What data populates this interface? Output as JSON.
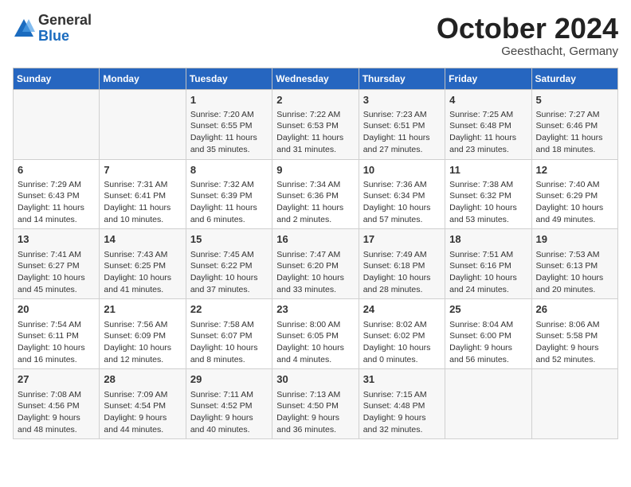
{
  "header": {
    "logo_general": "General",
    "logo_blue": "Blue",
    "month": "October 2024",
    "location": "Geesthacht, Germany"
  },
  "days_of_week": [
    "Sunday",
    "Monday",
    "Tuesday",
    "Wednesday",
    "Thursday",
    "Friday",
    "Saturday"
  ],
  "weeks": [
    [
      {
        "num": "",
        "info": ""
      },
      {
        "num": "",
        "info": ""
      },
      {
        "num": "1",
        "info": "Sunrise: 7:20 AM\nSunset: 6:55 PM\nDaylight: 11 hours and 35 minutes."
      },
      {
        "num": "2",
        "info": "Sunrise: 7:22 AM\nSunset: 6:53 PM\nDaylight: 11 hours and 31 minutes."
      },
      {
        "num": "3",
        "info": "Sunrise: 7:23 AM\nSunset: 6:51 PM\nDaylight: 11 hours and 27 minutes."
      },
      {
        "num": "4",
        "info": "Sunrise: 7:25 AM\nSunset: 6:48 PM\nDaylight: 11 hours and 23 minutes."
      },
      {
        "num": "5",
        "info": "Sunrise: 7:27 AM\nSunset: 6:46 PM\nDaylight: 11 hours and 18 minutes."
      }
    ],
    [
      {
        "num": "6",
        "info": "Sunrise: 7:29 AM\nSunset: 6:43 PM\nDaylight: 11 hours and 14 minutes."
      },
      {
        "num": "7",
        "info": "Sunrise: 7:31 AM\nSunset: 6:41 PM\nDaylight: 11 hours and 10 minutes."
      },
      {
        "num": "8",
        "info": "Sunrise: 7:32 AM\nSunset: 6:39 PM\nDaylight: 11 hours and 6 minutes."
      },
      {
        "num": "9",
        "info": "Sunrise: 7:34 AM\nSunset: 6:36 PM\nDaylight: 11 hours and 2 minutes."
      },
      {
        "num": "10",
        "info": "Sunrise: 7:36 AM\nSunset: 6:34 PM\nDaylight: 10 hours and 57 minutes."
      },
      {
        "num": "11",
        "info": "Sunrise: 7:38 AM\nSunset: 6:32 PM\nDaylight: 10 hours and 53 minutes."
      },
      {
        "num": "12",
        "info": "Sunrise: 7:40 AM\nSunset: 6:29 PM\nDaylight: 10 hours and 49 minutes."
      }
    ],
    [
      {
        "num": "13",
        "info": "Sunrise: 7:41 AM\nSunset: 6:27 PM\nDaylight: 10 hours and 45 minutes."
      },
      {
        "num": "14",
        "info": "Sunrise: 7:43 AM\nSunset: 6:25 PM\nDaylight: 10 hours and 41 minutes."
      },
      {
        "num": "15",
        "info": "Sunrise: 7:45 AM\nSunset: 6:22 PM\nDaylight: 10 hours and 37 minutes."
      },
      {
        "num": "16",
        "info": "Sunrise: 7:47 AM\nSunset: 6:20 PM\nDaylight: 10 hours and 33 minutes."
      },
      {
        "num": "17",
        "info": "Sunrise: 7:49 AM\nSunset: 6:18 PM\nDaylight: 10 hours and 28 minutes."
      },
      {
        "num": "18",
        "info": "Sunrise: 7:51 AM\nSunset: 6:16 PM\nDaylight: 10 hours and 24 minutes."
      },
      {
        "num": "19",
        "info": "Sunrise: 7:53 AM\nSunset: 6:13 PM\nDaylight: 10 hours and 20 minutes."
      }
    ],
    [
      {
        "num": "20",
        "info": "Sunrise: 7:54 AM\nSunset: 6:11 PM\nDaylight: 10 hours and 16 minutes."
      },
      {
        "num": "21",
        "info": "Sunrise: 7:56 AM\nSunset: 6:09 PM\nDaylight: 10 hours and 12 minutes."
      },
      {
        "num": "22",
        "info": "Sunrise: 7:58 AM\nSunset: 6:07 PM\nDaylight: 10 hours and 8 minutes."
      },
      {
        "num": "23",
        "info": "Sunrise: 8:00 AM\nSunset: 6:05 PM\nDaylight: 10 hours and 4 minutes."
      },
      {
        "num": "24",
        "info": "Sunrise: 8:02 AM\nSunset: 6:02 PM\nDaylight: 10 hours and 0 minutes."
      },
      {
        "num": "25",
        "info": "Sunrise: 8:04 AM\nSunset: 6:00 PM\nDaylight: 9 hours and 56 minutes."
      },
      {
        "num": "26",
        "info": "Sunrise: 8:06 AM\nSunset: 5:58 PM\nDaylight: 9 hours and 52 minutes."
      }
    ],
    [
      {
        "num": "27",
        "info": "Sunrise: 7:08 AM\nSunset: 4:56 PM\nDaylight: 9 hours and 48 minutes."
      },
      {
        "num": "28",
        "info": "Sunrise: 7:09 AM\nSunset: 4:54 PM\nDaylight: 9 hours and 44 minutes."
      },
      {
        "num": "29",
        "info": "Sunrise: 7:11 AM\nSunset: 4:52 PM\nDaylight: 9 hours and 40 minutes."
      },
      {
        "num": "30",
        "info": "Sunrise: 7:13 AM\nSunset: 4:50 PM\nDaylight: 9 hours and 36 minutes."
      },
      {
        "num": "31",
        "info": "Sunrise: 7:15 AM\nSunset: 4:48 PM\nDaylight: 9 hours and 32 minutes."
      },
      {
        "num": "",
        "info": ""
      },
      {
        "num": "",
        "info": ""
      }
    ]
  ]
}
